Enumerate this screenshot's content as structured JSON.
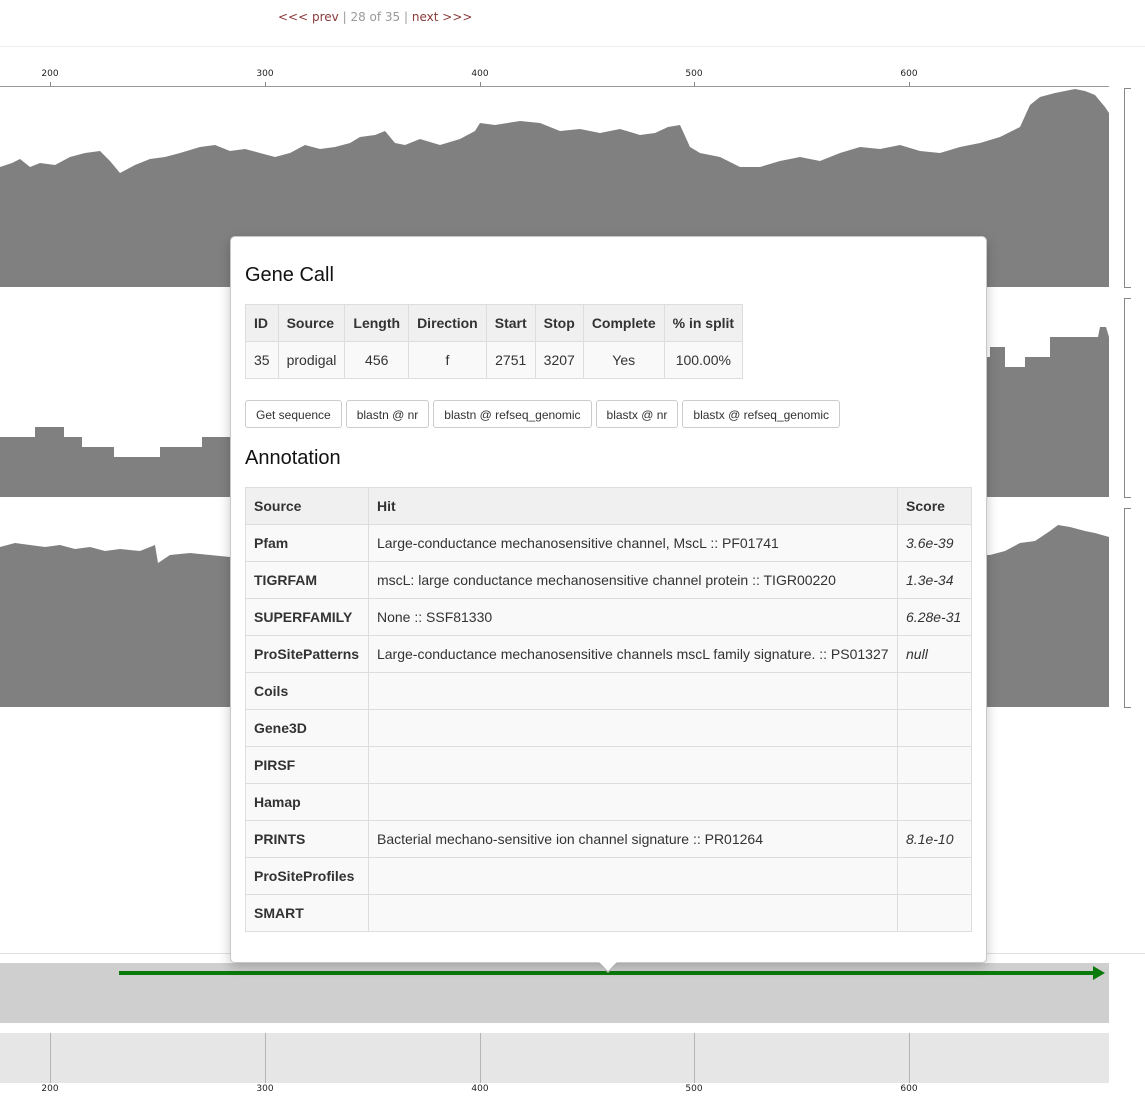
{
  "pager": {
    "prev": "<<< prev",
    "position": "28 of 35",
    "next": "next >>>"
  },
  "ruler": {
    "ticks": [
      "200",
      "300",
      "400",
      "500",
      "600"
    ]
  },
  "colors": {
    "coverage": "#808080",
    "gene_arrow": "#0a7a0a",
    "gene_track": "#cfcfcf"
  },
  "gene_call": {
    "title": "Gene Call",
    "columns": [
      "ID",
      "Source",
      "Length",
      "Direction",
      "Start",
      "Stop",
      "Complete",
      "% in split"
    ],
    "row": [
      "35",
      "prodigal",
      "456",
      "f",
      "2751",
      "3207",
      "Yes",
      "100.00%"
    ],
    "buttons": [
      "Get sequence",
      "blastn @ nr",
      "blastn @ refseq_genomic",
      "blastx @ nr",
      "blastx @ refseq_genomic"
    ]
  },
  "annotation": {
    "title": "Annotation",
    "columns": [
      "Source",
      "Hit",
      "Score"
    ],
    "rows": [
      {
        "source": "Pfam",
        "hit": "Large-conductance mechanosensitive channel, MscL :: PF01741",
        "score": "3.6e-39"
      },
      {
        "source": "TIGRFAM",
        "hit": "mscL: large conductance mechanosensitive channel protein :: TIGR00220",
        "score": "1.3e-34"
      },
      {
        "source": "SUPERFAMILY",
        "hit": "None :: SSF81330",
        "score": "6.28e-31"
      },
      {
        "source": "ProSitePatterns",
        "hit": "Large-conductance mechanosensitive channels mscL family signature. :: PS01327",
        "score": "null"
      },
      {
        "source": "Coils",
        "hit": "",
        "score": ""
      },
      {
        "source": "Gene3D",
        "hit": "",
        "score": ""
      },
      {
        "source": "PIRSF",
        "hit": "",
        "score": ""
      },
      {
        "source": "Hamap",
        "hit": "",
        "score": ""
      },
      {
        "source": "PRINTS",
        "hit": "Bacterial mechano-sensitive ion channel signature :: PR01264",
        "score": "8.1e-10"
      },
      {
        "source": "ProSiteProfiles",
        "hit": "",
        "score": ""
      },
      {
        "source": "SMART",
        "hit": "",
        "score": ""
      }
    ]
  }
}
